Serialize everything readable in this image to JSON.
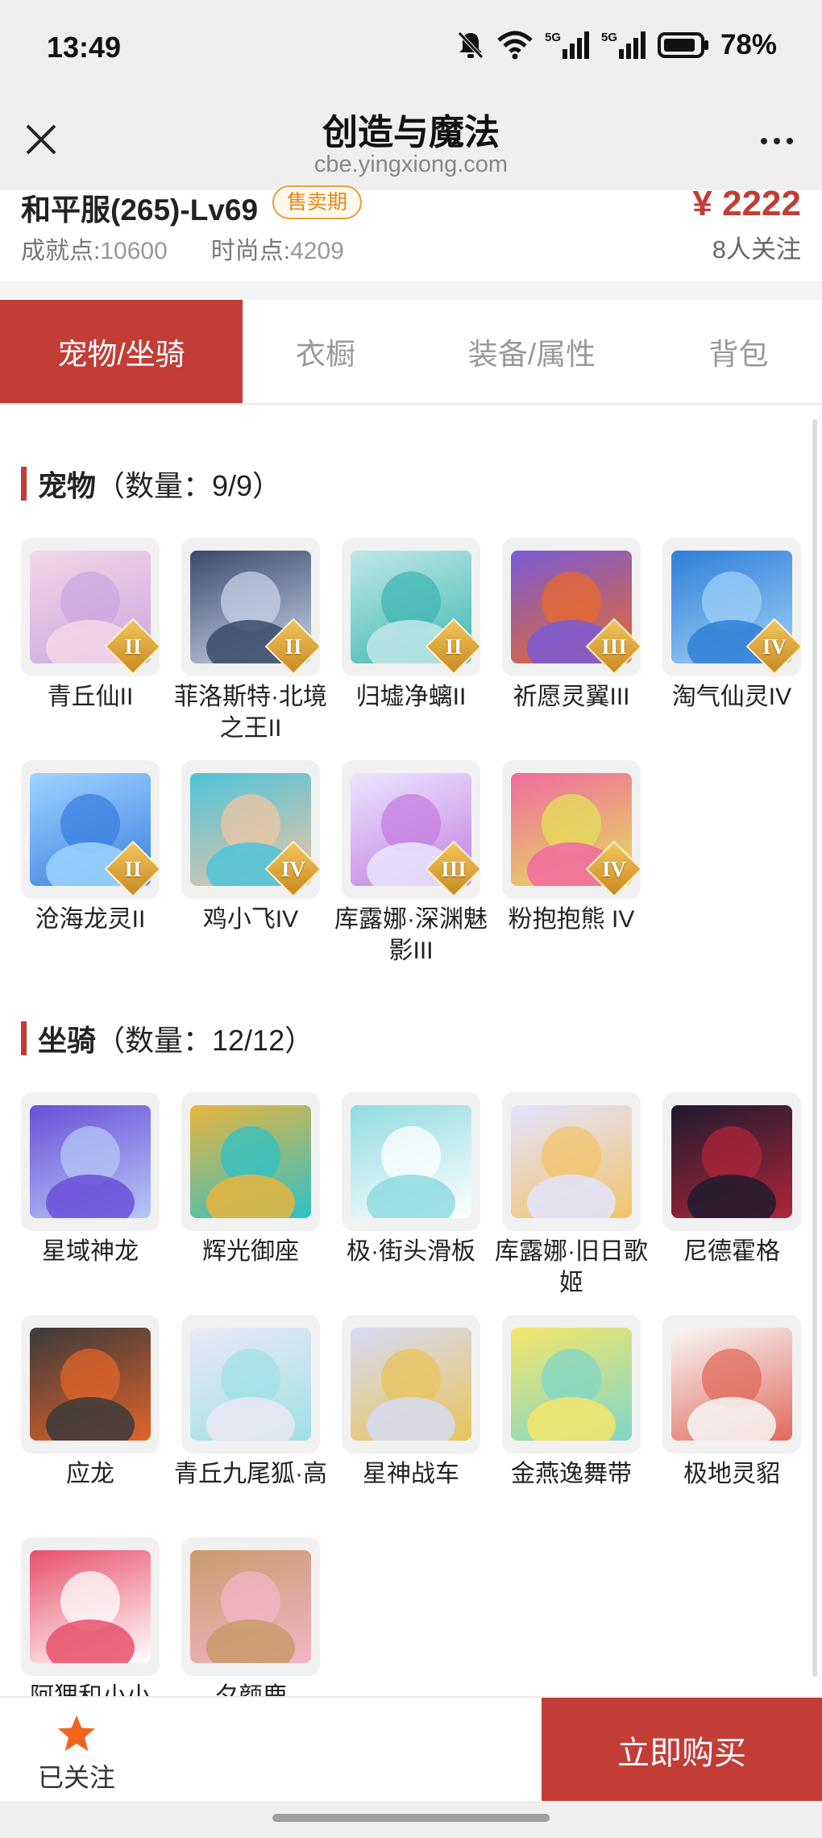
{
  "status_bar": {
    "time": "13:49",
    "signal_1": "5G",
    "signal_2": "5G",
    "battery": "78%"
  },
  "browser": {
    "title": "创造与魔法",
    "url": "cbe.yingxiong.com",
    "close_icon": "close-icon",
    "more_icon": "more-dots-icon"
  },
  "listing": {
    "server": "和平服(265)-Lv69",
    "badge": "售卖期",
    "price": "¥ 2222",
    "achievement_label": "成就点:",
    "achievement_value": "10600",
    "fashion_label": "时尚点:",
    "fashion_value": "4209",
    "followers": "8人关注"
  },
  "tabs": [
    {
      "label": "宠物/坐骑",
      "active": true
    },
    {
      "label": "衣橱",
      "active": false
    },
    {
      "label": "装备/属性",
      "active": false
    },
    {
      "label": "背包",
      "active": false
    }
  ],
  "pets": {
    "title": "宠物",
    "count": "（数量：9/9）",
    "items": [
      {
        "name": "青丘仙II",
        "grade": "II",
        "c1": "#f3d6e6",
        "c2": "#c9a7e0"
      },
      {
        "name": "菲洛斯特·北境之王II",
        "grade": "II",
        "c1": "#3a4b6a",
        "c2": "#c7d3e8"
      },
      {
        "name": "归墟净螭II",
        "grade": "II",
        "c1": "#bfe8e6",
        "c2": "#3fb6b2"
      },
      {
        "name": "祈愿灵翼III",
        "grade": "III",
        "c1": "#7a5bd6",
        "c2": "#e86a2a"
      },
      {
        "name": "淘气仙灵IV",
        "grade": "IV",
        "c1": "#2f7fd8",
        "c2": "#9fd0f5"
      },
      {
        "name": "沧海龙灵II",
        "grade": "II",
        "c1": "#9fd3ff",
        "c2": "#3a7fe0"
      },
      {
        "name": "鸡小飞IV",
        "grade": "IV",
        "c1": "#4cc3d8",
        "c2": "#f0c6a4"
      },
      {
        "name": "库露娜·深渊魅影III",
        "grade": "III",
        "c1": "#e9e6ff",
        "c2": "#c47de0"
      },
      {
        "name": "粉抱抱熊 IV",
        "grade": "IV",
        "c1": "#f06aa0",
        "c2": "#e4e05a"
      }
    ]
  },
  "mounts": {
    "title": "坐骑",
    "count": "（数量：12/12）",
    "items": [
      {
        "name": "星域神龙",
        "c1": "#6a4fd8",
        "c2": "#b6c8f5"
      },
      {
        "name": "辉光御座",
        "c1": "#e8b53c",
        "c2": "#2fc0c8"
      },
      {
        "name": "极·街头滑板",
        "c1": "#8fdbe0",
        "c2": "#ffffff"
      },
      {
        "name": "库露娜·旧日歌姬",
        "c1": "#e2e4ff",
        "c2": "#f3c36a"
      },
      {
        "name": "尼德霍格",
        "c1": "#1e1b2e",
        "c2": "#b0253a"
      },
      {
        "name": "应龙",
        "c1": "#3a3a3a",
        "c2": "#e2642a"
      },
      {
        "name": "青丘九尾狐·高",
        "c1": "#eae8f5",
        "c2": "#9fe0e6"
      },
      {
        "name": "星神战车",
        "c1": "#d6dbf5",
        "c2": "#e9c45a"
      },
      {
        "name": "金燕逸舞带",
        "c1": "#f5e66a",
        "c2": "#7fd6c8"
      },
      {
        "name": "极地灵貂",
        "c1": "#f7f7f7",
        "c2": "#e06a5a"
      },
      {
        "name": "阿狸和小小",
        "c1": "#e8506a",
        "c2": "#ffffff"
      },
      {
        "name": "夕颜鹿",
        "c1": "#c89a6a",
        "c2": "#f3b6c8"
      }
    ]
  },
  "bottom_bar": {
    "follow_label": "已关注",
    "follow_icon": "star-icon",
    "buy_label": "立即购买",
    "accent": "#c13d35",
    "star_color": "#f2641e"
  }
}
